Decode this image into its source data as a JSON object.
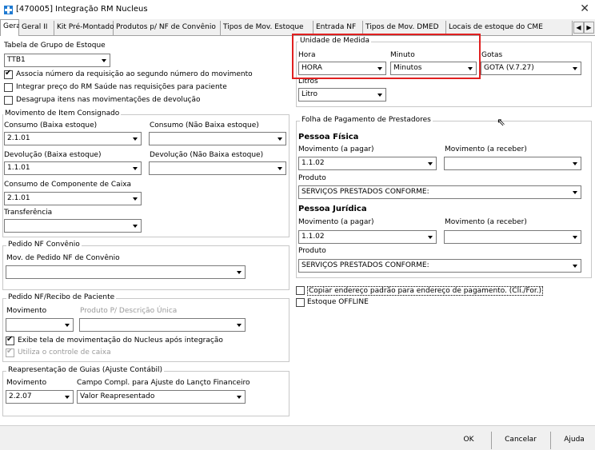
{
  "window": {
    "title": "[470005] Integração RM Nucleus",
    "close_glyph": "✕"
  },
  "tabs": [
    "Geral",
    "Geral II",
    "Kit Pré-Montado",
    "Produtos p/ NF de Convênio",
    "Tipos de Mov. Estoque",
    "Entrada NF",
    "Tipos de Mov. DMED",
    "Locais de estoque do CME"
  ],
  "left": {
    "tabela_grupo_label": "Tabela de Grupo de Estoque",
    "tabela_grupo_value": "TTB1",
    "opt_associa": "Associa número da requisição ao segundo número do movimento",
    "opt_integrar": "Integrar preço do RM Saúde nas requisições para paciente",
    "opt_desagrupa": "Desagrupa itens nas movimentações de  devolução",
    "consignado": {
      "title": "Movimento de Item Consignado",
      "consumo_baixa_label": "Consumo (Baixa estoque)",
      "consumo_baixa_value": "2.1.01",
      "consumo_nao_label": "Consumo (Não Baixa estoque)",
      "consumo_nao_value": "",
      "devolucao_baixa_label": "Devolução (Baixa estoque)",
      "devolucao_baixa_value": "1.1.01",
      "devolucao_nao_label": "Devolução (Não Baixa estoque)",
      "devolucao_nao_value": "",
      "componente_label": "Consumo de Componente de Caixa",
      "componente_value": "2.1.01",
      "transferencia_label": "Transferência",
      "transferencia_value": ""
    },
    "pedido_convenio": {
      "title": "Pedido NF Convênio",
      "mov_label": "Mov. de Pedido NF de Convênio",
      "mov_value": ""
    },
    "pedido_paciente": {
      "title": "Pedido NF/Recibo de Paciente",
      "movimento_label": "Movimento",
      "produto_label": "Produto P/ Descrição Única",
      "opt_exibe": "Exibe tela de movimentação do Nucleus após integração",
      "opt_utiliza": "Utiliza o controle de caixa"
    },
    "reapresentacao": {
      "title": "Reapresentação de Guias (Ajuste Contábil)",
      "movimento_label": "Movimento",
      "movimento_value": "2.2.07",
      "campo_label": "Campo Compl. para Ajuste do Lançto Financeiro",
      "campo_value": "Valor Reapresentado"
    }
  },
  "right": {
    "unidade": {
      "title": "Unidade de Medida",
      "hora_label": "Hora",
      "hora_value": "HORA",
      "minuto_label": "Minuto",
      "minuto_value": "Minutos",
      "gotas_label": "Gotas",
      "gotas_value": "GOTA (V.7.27)",
      "litros_label": "Litros",
      "litros_value": "Litro"
    },
    "folha": {
      "title": "Folha de Pagamento de Prestadores",
      "pf_title": "Pessoa Física",
      "pf_mov_pagar_label": "Movimento (a pagar)",
      "pf_mov_pagar_value": "1.1.02",
      "pf_mov_receber_label": "Movimento (a receber)",
      "pf_mov_receber_value": "",
      "pf_produto_label": "Produto",
      "pf_produto_value": "SERVIÇOS PRESTADOS CONFORME:",
      "pj_title": "Pessoa Jurídica",
      "pj_mov_pagar_label": "Movimento (a pagar)",
      "pj_mov_pagar_value": "1.1.02",
      "pj_mov_receber_label": "Movimento (a receber)",
      "pj_mov_receber_value": "",
      "pj_produto_label": "Produto",
      "pj_produto_value": "SERVIÇOS PRESTADOS CONFORME:"
    },
    "opt_copiar": "Copiar endereço padrão para endereço de pagamento. (Cli./For.)",
    "opt_offline": "Estoque OFFLINE"
  },
  "footer": {
    "ok": "OK",
    "cancelar": "Cancelar",
    "ajuda": "Ajuda"
  },
  "colors": {
    "highlight": "#e02020",
    "app_icon": "#1e7ad1"
  }
}
